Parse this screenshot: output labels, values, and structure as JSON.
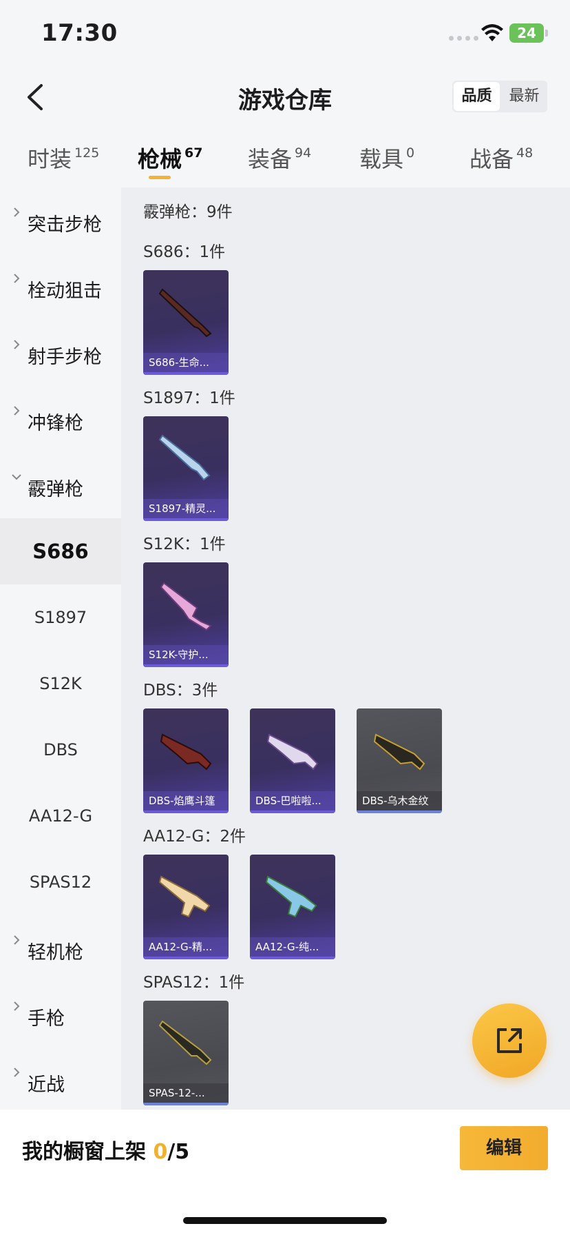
{
  "status_bar": {
    "time": "17:30",
    "battery": "24"
  },
  "header": {
    "title": "游戏仓库"
  },
  "sort": {
    "quality": "品质",
    "newest": "最新"
  },
  "tabs": [
    {
      "label": "时装",
      "count": "125"
    },
    {
      "label": "枪械",
      "count": "67"
    },
    {
      "label": "装备",
      "count": "94"
    },
    {
      "label": "载具",
      "count": "0"
    },
    {
      "label": "战备",
      "count": "48"
    }
  ],
  "sidebar": {
    "categories": [
      "突击步枪",
      "栓动狙击",
      "射手步枪",
      "冲锋枪",
      "霰弹枪",
      "轻机枪",
      "手枪",
      "近战"
    ],
    "subs": [
      "S686",
      "S1897",
      "S12K",
      "DBS",
      "AA12-G",
      "SPAS12"
    ]
  },
  "content": {
    "summary": "霰弹枪：9件",
    "groups": [
      {
        "title": "S686：1件",
        "items": [
          "S686-生命..."
        ]
      },
      {
        "title": "S1897：1件",
        "items": [
          "S1897-精灵..."
        ]
      },
      {
        "title": "S12K：1件",
        "items": [
          "S12K-守护..."
        ]
      },
      {
        "title": "DBS：3件",
        "items": [
          "DBS-焰鹰斗篷",
          "DBS-巴啦啦...",
          "DBS-乌木金纹"
        ]
      },
      {
        "title": "AA12-G：2件",
        "items": [
          "AA12-G-精...",
          "AA12-G-纯..."
        ]
      },
      {
        "title": "SPAS12：1件",
        "items": [
          "SPAS-12-..."
        ]
      }
    ]
  },
  "bottom_bar": {
    "label": "我的橱窗上架 ",
    "current": "0",
    "total": "/5",
    "edit": "编辑"
  },
  "colors": {
    "accent": "#f2b233",
    "card_purple": "#3d3359",
    "card_gray": "#4a4b51"
  }
}
